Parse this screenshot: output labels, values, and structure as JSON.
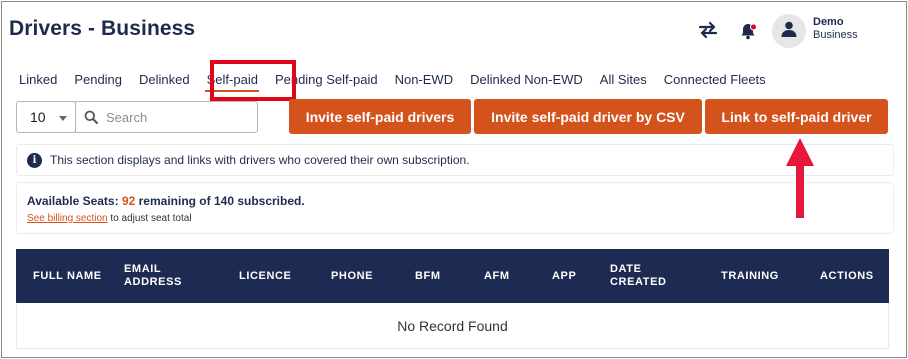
{
  "header": {
    "title": "Drivers - Business",
    "user_name": "Demo",
    "user_role": "Business",
    "icons": [
      "swap-arrows-icon",
      "bell-icon",
      "user-avatar-icon"
    ]
  },
  "tabs": [
    {
      "label": "Linked",
      "active": false
    },
    {
      "label": "Pending",
      "active": false
    },
    {
      "label": "Delinked",
      "active": false
    },
    {
      "label": "Self-paid",
      "active": true
    },
    {
      "label": "Pending Self-paid",
      "active": false
    },
    {
      "label": "Non-EWD",
      "active": false
    },
    {
      "label": "Delinked Non-EWD",
      "active": false
    },
    {
      "label": "All Sites",
      "active": false
    },
    {
      "label": "Connected Fleets",
      "active": false
    }
  ],
  "toolbar": {
    "per_page": "10",
    "search_placeholder": "Search",
    "invite_label": "Invite self-paid drivers",
    "csv_label": "Invite self-paid driver by CSV",
    "link_label": "Link to self-paid driver"
  },
  "info": {
    "text": "This section displays and links with drivers who covered their own subscription."
  },
  "seats": {
    "prefix": "Available Seats: ",
    "count": "92",
    "suffix": " remaining of 140 subscribed.",
    "billing_link": "See billing section",
    "billing_rest": " to adjust seat total"
  },
  "table": {
    "columns": [
      "FULL NAME",
      "EMAIL ADDRESS",
      "LICENCE",
      "PHONE",
      "BFM",
      "AFM",
      "APP",
      "DATE CREATED",
      "TRAINING",
      "ACTIONS"
    ],
    "empty_text": "No Record Found"
  },
  "colors": {
    "accent": "#d4521c",
    "navy": "#1d2b52",
    "highlight_red": "#e0061b"
  }
}
